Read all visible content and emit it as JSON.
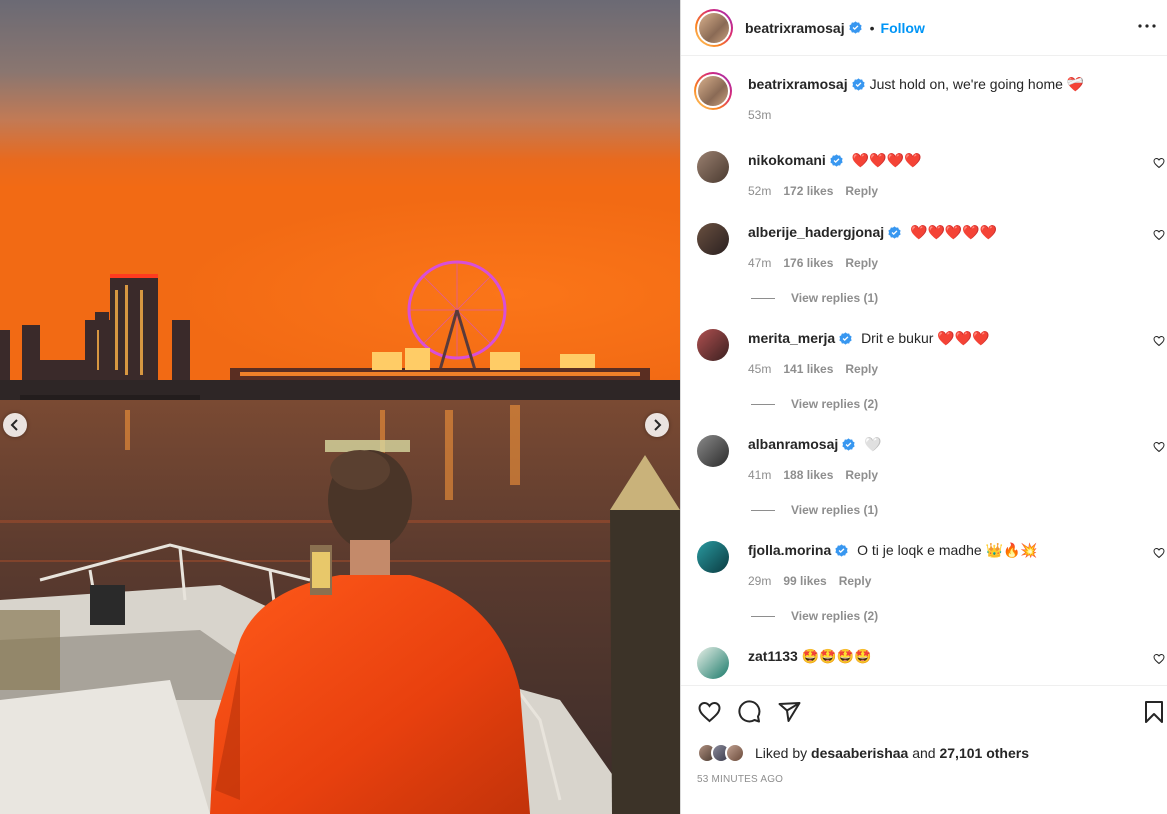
{
  "post": {
    "author": "beatrixramosaj",
    "follow_label": "Follow",
    "dot": "•",
    "caption": "Just hold on, we're going home",
    "caption_emoji": "❤️‍🩹",
    "caption_time": "53m"
  },
  "comments": [
    {
      "username": "nikokomani",
      "text": "",
      "emoji": "❤️❤️❤️❤️",
      "time": "52m",
      "likes": "172 likes",
      "reply_label": "Reply",
      "view_replies": ""
    },
    {
      "username": "alberije_hadergjonaj",
      "text": "",
      "emoji": "❤️❤️❤️❤️❤️",
      "time": "47m",
      "likes": "176 likes",
      "reply_label": "Reply",
      "view_replies": "View replies (1)"
    },
    {
      "username": "merita_merja",
      "text": "Drit e bukur",
      "emoji": "❤️❤️❤️",
      "time": "45m",
      "likes": "141 likes",
      "reply_label": "Reply",
      "view_replies": "View replies (2)"
    },
    {
      "username": "albanramosaj",
      "text": "",
      "emoji": "🤍",
      "time": "41m",
      "likes": "188 likes",
      "reply_label": "Reply",
      "view_replies": "View replies (1)"
    },
    {
      "username": "fjolla.morina",
      "text": "O ti je loqk e madhe",
      "emoji": "👑🔥💥",
      "time": "29m",
      "likes": "99 likes",
      "reply_label": "Reply",
      "view_replies": "View replies (2)"
    },
    {
      "username": "zat1133",
      "text": "",
      "emoji": "🤩🤩🤩🤩",
      "time": "",
      "likes": "",
      "reply_label": "",
      "view_replies": ""
    }
  ],
  "likes": {
    "prefix": "Liked by",
    "user": "desaaberishaa",
    "middle": "and",
    "count": "27,101 others"
  },
  "timestamp": "53 MINUTES AGO",
  "colors": {
    "accent": "#0095f6",
    "verified": "#3897f0",
    "heart_red": "#ed4956"
  },
  "icons": [
    "chevron-left-icon",
    "chevron-right-icon",
    "verified-icon",
    "more-icon",
    "heart-icon",
    "comment-icon",
    "share-icon",
    "bookmark-icon"
  ]
}
